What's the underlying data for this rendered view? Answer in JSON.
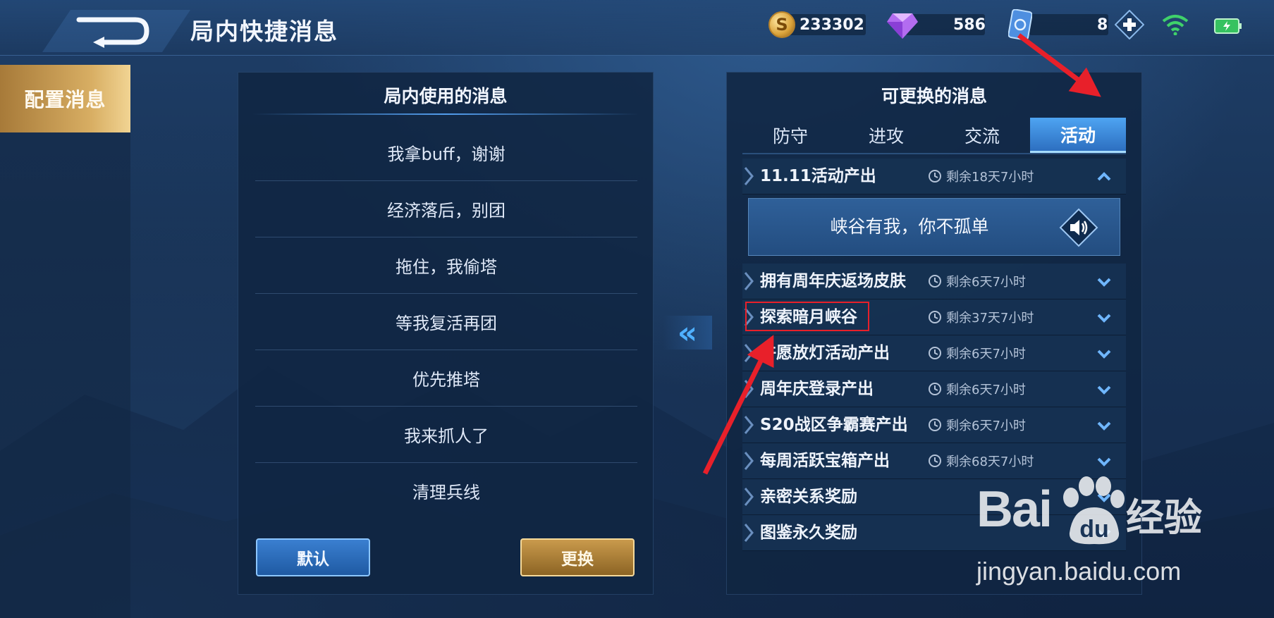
{
  "header": {
    "title": "局内快捷消息",
    "back_icon": "back-arrow-icon",
    "gold": "233302",
    "diamonds": "586",
    "tickets": "8",
    "plus_icon": "plus-icon",
    "wifi_icon": "wifi-icon",
    "battery_icon": "battery-icon"
  },
  "sidebar": {
    "items": [
      {
        "label": "配置消息",
        "active": true
      }
    ]
  },
  "left_panel": {
    "title": "局内使用的消息",
    "messages": [
      "我拿buff，谢谢",
      "经济落后，别团",
      "拖住，我偷塔",
      "等我复活再团",
      "优先推塔",
      "我来抓人了",
      "清理兵线"
    ],
    "default_button": "默认",
    "swap_button": "更换"
  },
  "transfer_arrow": "«",
  "right_panel": {
    "title": "可更换的消息",
    "tabs": [
      {
        "label": "防守",
        "active": false
      },
      {
        "label": "进攻",
        "active": false
      },
      {
        "label": "交流",
        "active": false
      },
      {
        "label": "活动",
        "active": true
      }
    ],
    "categories": [
      {
        "name": "11.11活动产出",
        "time": "剩余18天7小时",
        "expanded": true
      },
      {
        "name": "拥有周年庆返场皮肤",
        "time": "剩余6天7小时",
        "expanded": false
      },
      {
        "name": "探索暗月峡谷",
        "time": "剩余37天7小时",
        "expanded": false
      },
      {
        "name": "许愿放灯活动产出",
        "time": "剩余6天7小时",
        "expanded": false
      },
      {
        "name": "周年庆登录产出",
        "time": "剩余6天7小时",
        "expanded": false
      },
      {
        "name": "S20战区争霸赛产出",
        "time": "剩余6天7小时",
        "expanded": false
      },
      {
        "name": "每周活跃宝箱产出",
        "time": "剩余68天7小时",
        "expanded": false
      },
      {
        "name": "亲密关系奖励",
        "time": "",
        "expanded": false
      },
      {
        "name": "图鉴永久奖励",
        "time": "",
        "expanded": false
      }
    ],
    "expanded_message": "峡谷有我，你不孤单",
    "speaker_icon": "speaker-icon"
  },
  "watermark": {
    "logo_text": "Bai",
    "logo_paw": "du",
    "logo_cn": "经验",
    "url": "jingyan.baidu.com"
  },
  "colors": {
    "accent_blue": "#4ea4f2",
    "gold_tab": "#d8ae63",
    "annotation_red": "#e8202a"
  }
}
